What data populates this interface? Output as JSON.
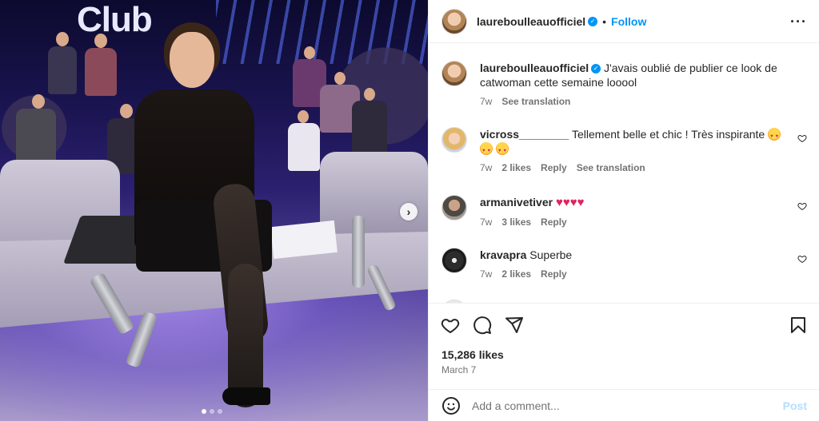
{
  "photo": {
    "sign_text": "Club",
    "carousel": {
      "total": 3,
      "active_index": 0
    }
  },
  "header": {
    "username": "laureboulleauofficiel",
    "separator": "•",
    "follow_label": "Follow",
    "more_icon": "more-horizontal-icon"
  },
  "caption": {
    "username": "laureboulleauofficiel",
    "text": "J'avais oublié de publier ce look de catwoman cette semaine looool",
    "age": "7w",
    "see_translation": "See translation"
  },
  "comments": [
    {
      "username": "vicross________",
      "text": "Tellement belle et chic ! Très inspirante",
      "emoji_count": 3,
      "age": "7w",
      "likes": "2 likes",
      "reply": "Reply",
      "see_translation": "See translation"
    },
    {
      "username": "armanivetiver",
      "text": "",
      "hearts": 4,
      "age": "7w",
      "likes": "3 likes",
      "reply": "Reply"
    },
    {
      "username": "kravapra",
      "text": "Superbe",
      "age": "7w",
      "likes": "2 likes",
      "reply": "Reply"
    }
  ],
  "actions": {
    "likes": "15,286 likes",
    "date": "March 7"
  },
  "add_comment": {
    "placeholder": "Add a comment...",
    "post_label": "Post"
  },
  "colors": {
    "accent": "#0095f6",
    "post_disabled": "#b2dffc",
    "heart_red": "#e0245e"
  }
}
